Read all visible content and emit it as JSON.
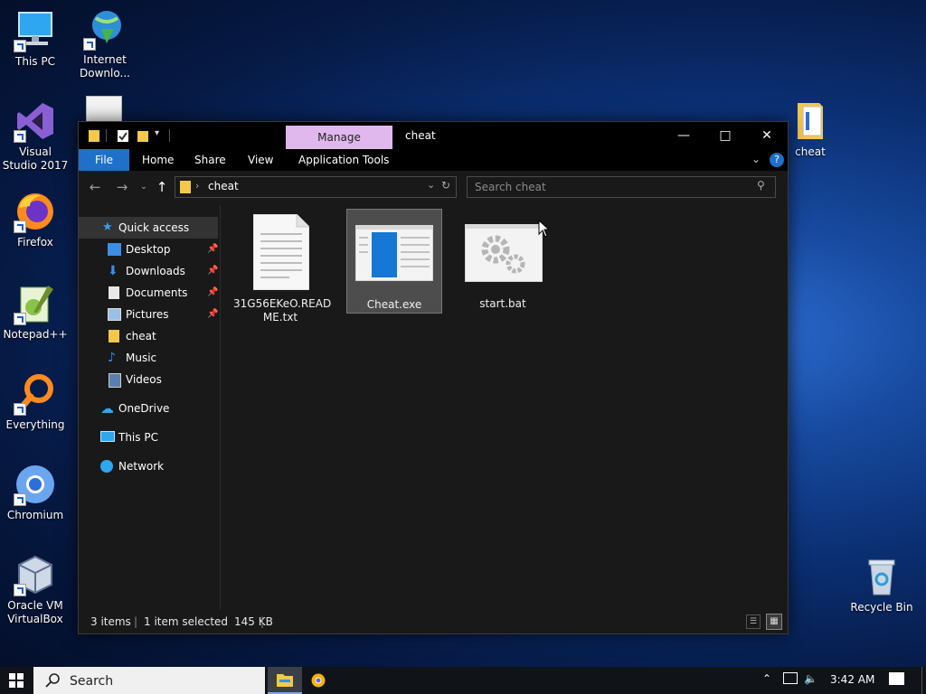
{
  "desktop": {
    "icons": [
      {
        "label": "This PC"
      },
      {
        "label": "Internet Downlo..."
      },
      {
        "label": "Visual Studio 2017"
      },
      {
        "label": "Firefox"
      },
      {
        "label": "Notepad++"
      },
      {
        "label": "Everything"
      },
      {
        "label": "Chromium"
      },
      {
        "label": "Oracle VM VirtualBox"
      },
      {
        "label": "cheat"
      },
      {
        "label": "Recycle Bin"
      }
    ]
  },
  "window": {
    "title": "cheat",
    "manage_tab": "Manage",
    "ribbon_tabs": [
      "File",
      "Home",
      "Share",
      "View",
      "Application Tools"
    ],
    "address_path": "cheat",
    "search_placeholder": "Search cheat",
    "nav": {
      "quick_access": "Quick access",
      "items": [
        {
          "label": "Desktop",
          "pinned": true
        },
        {
          "label": "Downloads",
          "pinned": true
        },
        {
          "label": "Documents",
          "pinned": true
        },
        {
          "label": "Pictures",
          "pinned": true
        },
        {
          "label": "cheat",
          "pinned": false
        },
        {
          "label": "Music",
          "pinned": false
        },
        {
          "label": "Videos",
          "pinned": false
        }
      ],
      "onedrive": "OneDrive",
      "this_pc": "This PC",
      "network": "Network"
    },
    "files": [
      {
        "name": "31G56EKeO.README.txt",
        "name_line1": "31G56EKeO.READ",
        "name_line2": "ME.txt",
        "selected": false
      },
      {
        "name": "Cheat.exe",
        "selected": true
      },
      {
        "name": "start.bat",
        "selected": false
      }
    ],
    "status": {
      "items": "3 items",
      "selected": "1 item selected",
      "size": "145 KB"
    }
  },
  "taskbar": {
    "search_placeholder": "Search",
    "clock": "3:42 AM"
  },
  "colors": {
    "file_tab": "#1f70c8",
    "manage_tab": "#e0b8ee",
    "window_bg": "#191919",
    "folder_yellow": "#f5c84c"
  }
}
